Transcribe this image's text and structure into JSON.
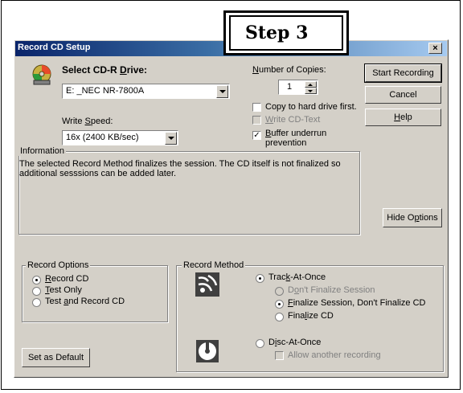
{
  "step_label": "Step 3",
  "window": {
    "title": "Record CD Setup",
    "close_glyph": "×"
  },
  "drive": {
    "label_pre": "Select CD-R ",
    "label_accel": "D",
    "label_post": "rive:",
    "selected": "E: _NEC NR-7800A"
  },
  "speed": {
    "label_pre": "Write ",
    "label_accel": "S",
    "label_post": "peed:",
    "selected": "16x (2400 KB/sec)"
  },
  "copies": {
    "label_accel": "N",
    "label_post": "umber of Copies:",
    "value": "1"
  },
  "options": {
    "copy_to_hd": {
      "label": "Copy to hard drive first.",
      "checked": false
    },
    "write_cd_text": {
      "label_accel": "W",
      "label_post": "rite CD-Text",
      "checked": false,
      "disabled": true
    },
    "buffer_underrun": {
      "label_accel": "B",
      "label_post": "uffer underrun",
      "label_line2": "prevention",
      "checked": true
    }
  },
  "buttons": {
    "start_recording": "Start Recording",
    "cancel": "Cancel",
    "help_accel": "H",
    "help_post": "elp",
    "hide_options_pre": "Hide O",
    "hide_options_accel": "p",
    "hide_options_post": "tions",
    "set_default": "Set as Default"
  },
  "information": {
    "legend": "Information",
    "text_line1": "The selected Record Method finalizes the session. The CD itself is not finalized so",
    "text_line2": "additional sesssions can be added later."
  },
  "record_options": {
    "legend": "Record Options",
    "items": [
      {
        "accel": "R",
        "post": "ecord CD",
        "pre": "",
        "selected": true
      },
      {
        "accel": "T",
        "post": "est Only",
        "pre": "",
        "selected": false
      },
      {
        "pre": "Test ",
        "accel": "a",
        "post": "nd Record CD",
        "selected": false
      }
    ]
  },
  "record_method": {
    "legend": "Record Method",
    "track_at_once": {
      "pre": "Trac",
      "accel": "k",
      "post": "-At-Once",
      "selected": true
    },
    "tao_sub": [
      {
        "pre": "D",
        "accel": "o",
        "post": "n't Finalize Session",
        "selected": false,
        "disabled": true
      },
      {
        "pre": "",
        "accel": "F",
        "post": "inalize Session, Don't Finalize CD",
        "selected": true,
        "disabled": false
      },
      {
        "pre": "Fina",
        "accel": "l",
        "post": "ize CD",
        "selected": false,
        "disabled": false
      }
    ],
    "disc_at_once": {
      "pre": "D",
      "accel": "i",
      "post": "sc-At-Once",
      "selected": false
    },
    "allow_another": {
      "label": "Allow another recording",
      "checked": false,
      "disabled": true
    }
  },
  "colors": {
    "dialog_bg": "#d4d0c8",
    "title_start": "#0a246a",
    "title_end": "#a6caf0"
  }
}
